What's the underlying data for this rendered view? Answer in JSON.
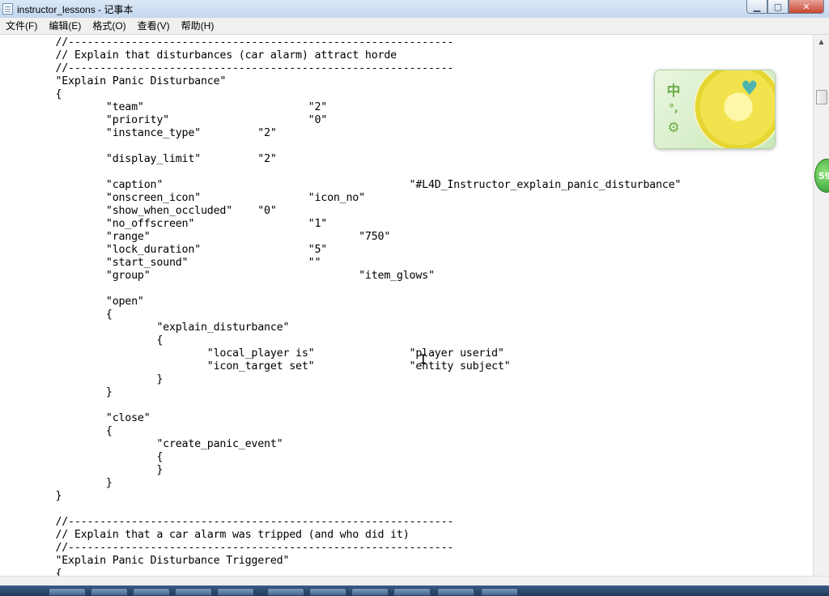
{
  "window": {
    "title": "instructor_lessons - 记事本",
    "minimize_label": "▁",
    "maximize_label": "▢",
    "close_label": "✕"
  },
  "menu": [
    "文件(F)",
    "编辑(E)",
    "格式(O)",
    "查看(V)",
    "帮助(H)"
  ],
  "editor": {
    "lines": [
      "\t//-------------------------------------------------------------",
      "\t// Explain that disturbances (car alarm) attract horde",
      "\t//-------------------------------------------------------------",
      "\t\"Explain Panic Disturbance\"",
      "\t{",
      "\t\t\"team\"\t\t\t\t\"2\"",
      "\t\t\"priority\"\t\t\t\"0\"",
      "\t\t\"instance_type\"\t\t\"2\"",
      "",
      "\t\t\"display_limit\"\t\t\"2\"",
      "",
      "\t\t\"caption\"\t\t\t\t\t\"#L4D_Instructor_explain_panic_disturbance\"",
      "\t\t\"onscreen_icon\"\t\t\t\"icon_no\"",
      "\t\t\"show_when_occluded\"\t\"0\"",
      "\t\t\"no_offscreen\"\t\t\t\"1\"",
      "\t\t\"range\"\t\t\t\t\t\"750\"",
      "\t\t\"lock_duration\"\t\t\t\"5\"",
      "\t\t\"start_sound\"\t\t\t\"\"",
      "\t\t\"group\"\t\t\t\t\t\"item_glows\"",
      "",
      "\t\t\"open\"",
      "\t\t{",
      "\t\t\t\"explain_disturbance\"",
      "\t\t\t{",
      "\t\t\t\t\"local_player is\"\t\t\"player userid\"",
      "\t\t\t\t\"icon_target set\"\t\t\"entity subject\"",
      "\t\t\t}",
      "\t\t}",
      "",
      "\t\t\"close\"",
      "\t\t{",
      "\t\t\t\"create_panic_event\"",
      "\t\t\t{",
      "\t\t\t}",
      "\t\t}",
      "\t}",
      "",
      "\t//-------------------------------------------------------------",
      "\t// Explain that a car alarm was tripped (and who did it)",
      "\t//-------------------------------------------------------------",
      "\t\"Explain Panic Disturbance Triggered\"",
      "\t{"
    ]
  },
  "ime": {
    "mode_label": "中",
    "punct_label": "°,",
    "settings_icon": "gear-icon"
  },
  "side_badge": {
    "label": "59"
  }
}
